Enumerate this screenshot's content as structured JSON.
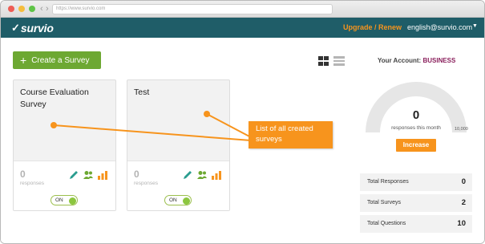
{
  "browser": {
    "url": "https://www.survio.com"
  },
  "header": {
    "logo_text": "survio",
    "upgrade_label": "Upgrade / Renew",
    "email": "english@survio.com"
  },
  "toolbar": {
    "create_label": "Create a Survey"
  },
  "surveys": [
    {
      "title": "Course Evaluation Survey",
      "responses": "0",
      "responses_label": "responses",
      "toggle": "ON"
    },
    {
      "title": "Test",
      "responses": "0",
      "responses_label": "responses",
      "toggle": "ON"
    }
  ],
  "callout": {
    "text": "List of all created surveys"
  },
  "account": {
    "label": "Your Account:",
    "plan": "BUSINESS",
    "responses_this_month": "0",
    "responses_sub": "responses this month",
    "max": "10,000",
    "usage_fraction": 0,
    "increase_label": "Increase"
  },
  "stats": [
    {
      "label": "Total Responses",
      "value": "0"
    },
    {
      "label": "Total Surveys",
      "value": "2"
    },
    {
      "label": "Total Questions",
      "value": "10"
    }
  ],
  "colors": {
    "topbar": "#1f5d68",
    "accent_orange": "#f7941d",
    "create_green": "#6da832",
    "plan_purple": "#8a1f5c"
  }
}
